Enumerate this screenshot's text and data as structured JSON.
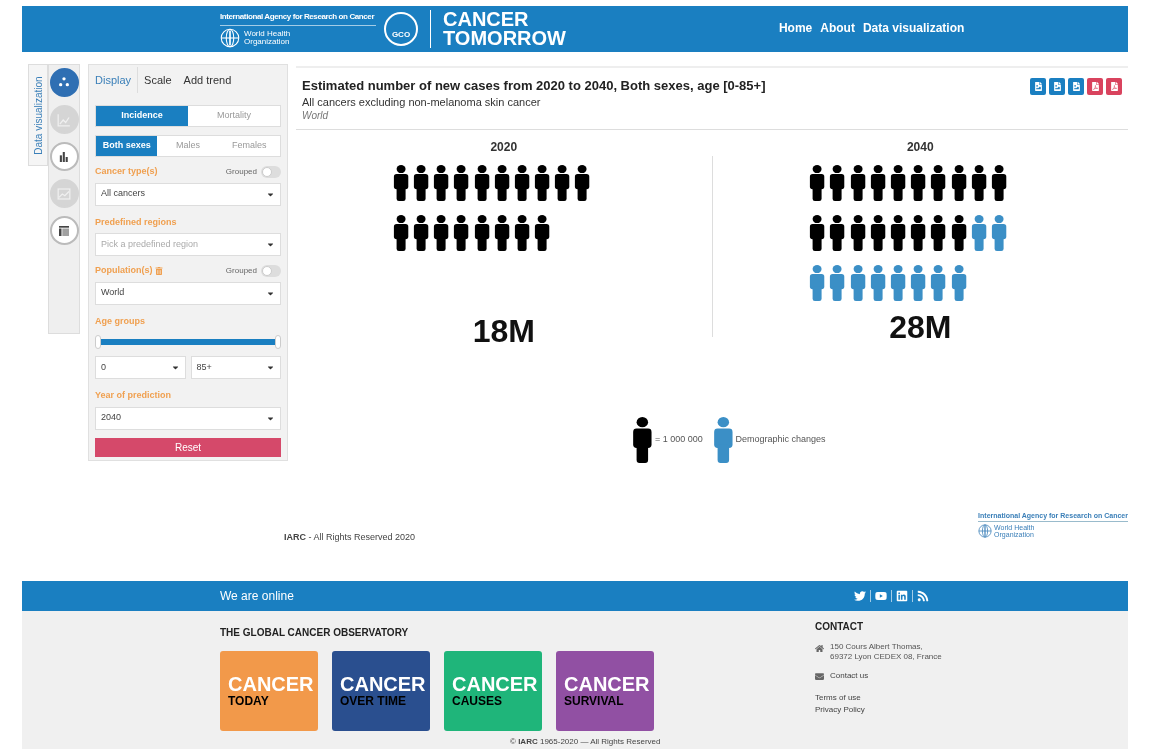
{
  "header": {
    "agency": "International Agency for Research on Cancer",
    "who": "World Health Organization",
    "gco": "GCO",
    "product_line1": "CANCER",
    "product_line2": "TOMORROW",
    "nav": [
      {
        "label": "Home"
      },
      {
        "label": "About"
      },
      {
        "label": "Data visualization"
      }
    ]
  },
  "side_tab": {
    "label": "Data visualization"
  },
  "side_icons": [
    {
      "kind": "dots",
      "selected": true,
      "disabled": false
    },
    {
      "kind": "area",
      "selected": false,
      "disabled": true
    },
    {
      "kind": "bars",
      "selected": false,
      "disabled": false
    },
    {
      "kind": "line",
      "selected": false,
      "disabled": true
    },
    {
      "kind": "table",
      "selected": false,
      "disabled": false
    }
  ],
  "panel": {
    "tabs": [
      {
        "label": "Display",
        "selected": true
      },
      {
        "label": "Scale",
        "selected": false
      },
      {
        "label": "Add trend",
        "selected": false
      }
    ],
    "indicator": [
      {
        "label": "Incidence",
        "selected": true
      },
      {
        "label": "Mortality",
        "selected": false
      }
    ],
    "sex": [
      {
        "label": "Both sexes",
        "selected": true
      },
      {
        "label": "Males",
        "selected": false
      },
      {
        "label": "Females",
        "selected": false
      }
    ],
    "cancer_types": {
      "label": "Cancer type(s)",
      "grouped_label": "Grouped",
      "on": false,
      "value": "All cancers"
    },
    "predefined_regions": {
      "label": "Predefined regions",
      "placeholder": "Pick a predefined region"
    },
    "populations": {
      "label": "Population(s)",
      "grouped_label": "Grouped",
      "on": false,
      "value": "World"
    },
    "age_groups": {
      "label": "Age groups",
      "level": 1,
      "from": "0",
      "to": "85+"
    },
    "year": {
      "label": "Year of prediction",
      "value": "2040"
    },
    "reset": "Reset"
  },
  "chart": {
    "title": "Estimated number of new cases from 2020 to 2040, Both sexes, age [0-85+]",
    "subtitle": "All cancers excluding non-melanoma skin cancer",
    "region": "World",
    "exports": [
      {
        "color": "#1a7fc1"
      },
      {
        "color": "#1a7fc1"
      },
      {
        "color": "#1a7fc1"
      },
      {
        "color": "#d9435e"
      },
      {
        "color": "#d9435e"
      }
    ],
    "years": [
      {
        "year": "2020",
        "total": "18M",
        "rows": [
          [
            {
              "kind": "base"
            },
            {
              "kind": "base"
            },
            {
              "kind": "base"
            },
            {
              "kind": "base"
            },
            {
              "kind": "base"
            },
            {
              "kind": "base"
            },
            {
              "kind": "base"
            },
            {
              "kind": "base"
            },
            {
              "kind": "base"
            },
            {
              "kind": "base"
            }
          ],
          [
            {
              "kind": "base"
            },
            {
              "kind": "base"
            },
            {
              "kind": "base"
            },
            {
              "kind": "base"
            },
            {
              "kind": "base"
            },
            {
              "kind": "base"
            },
            {
              "kind": "base"
            },
            {
              "kind": "base"
            }
          ]
        ]
      },
      {
        "year": "2040",
        "total": "28M",
        "rows": [
          [
            {
              "kind": "base"
            },
            {
              "kind": "base"
            },
            {
              "kind": "base"
            },
            {
              "kind": "base"
            },
            {
              "kind": "base"
            },
            {
              "kind": "base"
            },
            {
              "kind": "base"
            },
            {
              "kind": "base"
            },
            {
              "kind": "base"
            },
            {
              "kind": "base"
            }
          ],
          [
            {
              "kind": "base"
            },
            {
              "kind": "base"
            },
            {
              "kind": "base"
            },
            {
              "kind": "base"
            },
            {
              "kind": "base"
            },
            {
              "kind": "base"
            },
            {
              "kind": "base"
            },
            {
              "kind": "base"
            },
            {
              "kind": "demographic"
            },
            {
              "kind": "demographic"
            }
          ],
          [
            {
              "kind": "demographic"
            },
            {
              "kind": "demographic"
            },
            {
              "kind": "demographic"
            },
            {
              "kind": "demographic"
            },
            {
              "kind": "demographic"
            },
            {
              "kind": "demographic"
            },
            {
              "kind": "demographic"
            },
            {
              "kind": "demographic"
            }
          ]
        ]
      }
    ],
    "legend": [
      {
        "kind": "base",
        "label": "= 1 000 000"
      },
      {
        "kind": "demographic",
        "label": "Demographic changes"
      }
    ]
  },
  "page_footer": {
    "org": "IARC",
    "rights": " - All Rights Reserved 2020",
    "logo_agency": "International Agency for Research on Cancer",
    "logo_who": "World Health Organization"
  },
  "footer": {
    "online": "We are online",
    "social": [
      {
        "kind": "twitter"
      },
      {
        "kind": "youtube"
      },
      {
        "kind": "linkedin"
      },
      {
        "kind": "rss"
      }
    ],
    "gco_title": "THE GLOBAL CANCER OBSERVATORY",
    "cards": [
      {
        "line1": "CANCER",
        "line2": "TODAY",
        "color": "#f2994a"
      },
      {
        "line1": "CANCER",
        "line2": "OVER TIME",
        "color": "#2a4f8f"
      },
      {
        "line1": "CANCER",
        "line2": "CAUSES",
        "color": "#1fb57a"
      },
      {
        "line1": "CANCER",
        "line2": "SURVIVAL",
        "color": "#9150a3"
      }
    ],
    "contact_title": "CONTACT",
    "address_line1": "150 Cours Albert Thomas,",
    "address_line2": "69372 Lyon CEDEX 08, France",
    "contact_link": "Contact us",
    "links": [
      {
        "label": "Terms of use"
      },
      {
        "label": "Privacy Policy"
      }
    ],
    "copyright_sign": "©",
    "copyright_org": "IARC",
    "copyright": "1965-2020 — All Rights Reserved"
  }
}
